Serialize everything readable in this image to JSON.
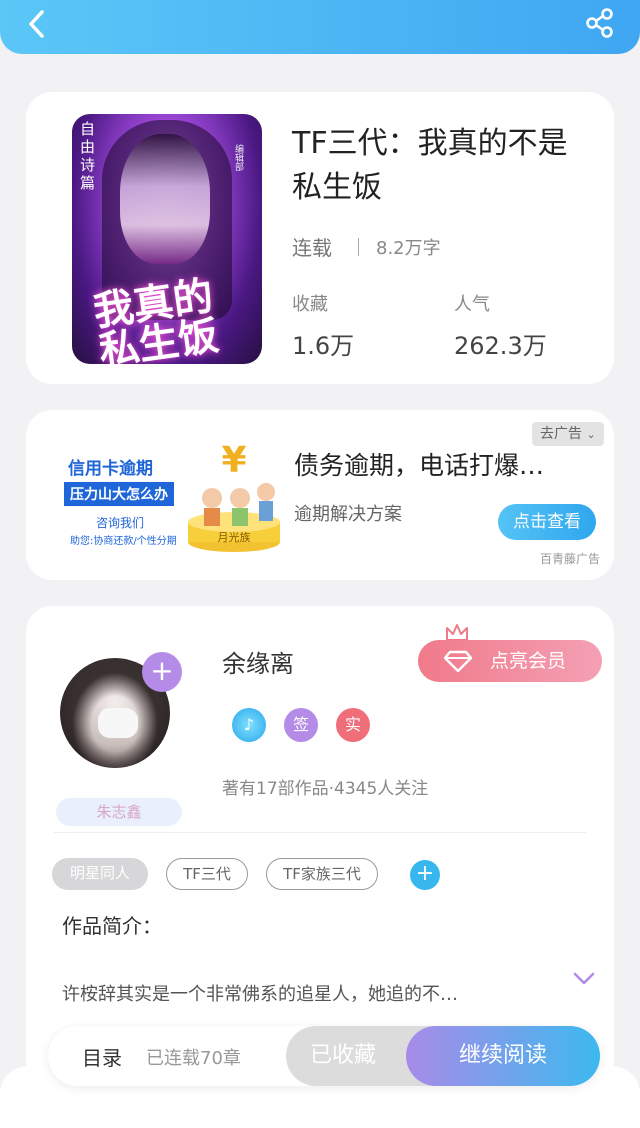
{
  "header": {
    "back_icon": "chevron-left-icon",
    "share_icon": "share-icon"
  },
  "book": {
    "title": "TF三代：我真的不是私生饭",
    "status": "连载",
    "word_count": "8.2万字",
    "cover": {
      "side_text": "自由诗篇",
      "title_art": "我真的私生饭",
      "author_art": "编辑部"
    },
    "stats": [
      {
        "label": "收藏",
        "value": "1.6万"
      },
      {
        "label": "人气",
        "value": "262.3万"
      }
    ]
  },
  "ad": {
    "image_text": {
      "line1": "信用卡逾期",
      "line2": "压力山大怎么办",
      "line3": "咨询我们",
      "line4": "助您:协商还款/个性分期",
      "banner": "月光族"
    },
    "title": "债务逾期，电话打爆…",
    "subtitle": "逾期解决方案",
    "remove_label": "去广告",
    "cta_label": "点击查看",
    "source": "百青藤广告"
  },
  "author": {
    "name": "余缘离",
    "fan_tag": "朱志鑫",
    "vip_label": "点亮会员",
    "badges": [
      {
        "label": "",
        "icon": "music-note-icon",
        "color": "#2aa6ea"
      },
      {
        "label": "签",
        "color": "#b58be8"
      },
      {
        "label": "实",
        "color": "#f06d7a"
      }
    ],
    "meta": "著有17部作品·4345人关注"
  },
  "tags": [
    "明星同人",
    "TF三代",
    "TF家族三代"
  ],
  "intro": {
    "label": "作品简介：",
    "text": "许桉辞其实是一个非常佛系的追星人，她追的不…"
  },
  "bottom": {
    "toc_label": "目录",
    "chapters": "已连载70章",
    "collected_label": "已收藏",
    "read_label": "继续阅读"
  },
  "colors": {
    "header": "#3fa7f2",
    "accent_blue": "#38b7ee",
    "accent_purple": "#b58be8",
    "vip_pink": "#f07a8a"
  }
}
